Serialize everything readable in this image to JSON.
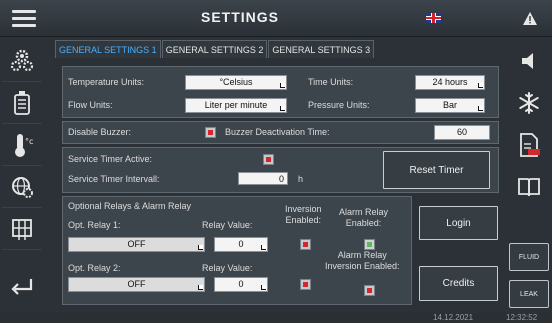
{
  "header": {
    "title": "SETTINGS"
  },
  "tabs": [
    {
      "label": "GENERAL SETTINGS 1",
      "active": true
    },
    {
      "label": "GENERAL SETTINGS 2",
      "active": false
    },
    {
      "label": "GENERAL SETTINGS 3",
      "active": false
    }
  ],
  "units": {
    "temperature_label": "Temperature Units:",
    "temperature_value": "°Celsius",
    "time_label": "Time Units:",
    "time_value": "24 hours",
    "flow_label": "Flow Units:",
    "flow_value": "Liter per minute",
    "pressure_label": "Pressure Units:",
    "pressure_value": "Bar"
  },
  "buzzer": {
    "disable_label": "Disable Buzzer:",
    "deactivation_label": "Buzzer Deactivation Time:",
    "deactivation_value": "60"
  },
  "service": {
    "active_label": "Service Timer Active:",
    "interval_label": "Service Timer Intervall:",
    "interval_value": "0",
    "interval_unit": "h",
    "reset_button": "Reset Timer"
  },
  "relays": {
    "section_title": "Optional Relays & Alarm Relay",
    "relay1_label": "Opt. Relay 1:",
    "relay1_value": "OFF",
    "relay_value_label_1": "Relay Value:",
    "relay1_relay_value": "0",
    "inversion_label": "Inversion\nEnabled:",
    "alarm_relay_label": "Alarm Relay\nEnabled:",
    "relay2_label": "Opt. Relay 2:",
    "relay2_value": "OFF",
    "relay_value_label_2": "Relay Value:",
    "relay2_relay_value": "0",
    "alarm_inversion_label": "Alarm Relay\nInversion Enabled:"
  },
  "side_buttons": {
    "login": "Login",
    "credits": "Credits",
    "fluid": "FLUID",
    "leak": "LEAK",
    "pdf": "PDF"
  },
  "footer": {
    "date": "14.12.2021",
    "time": "12:32:52"
  },
  "colors": {
    "accent": "#49b0ff",
    "checkbox_off": "#d4272d",
    "checkbox_on": "#64b36b"
  }
}
